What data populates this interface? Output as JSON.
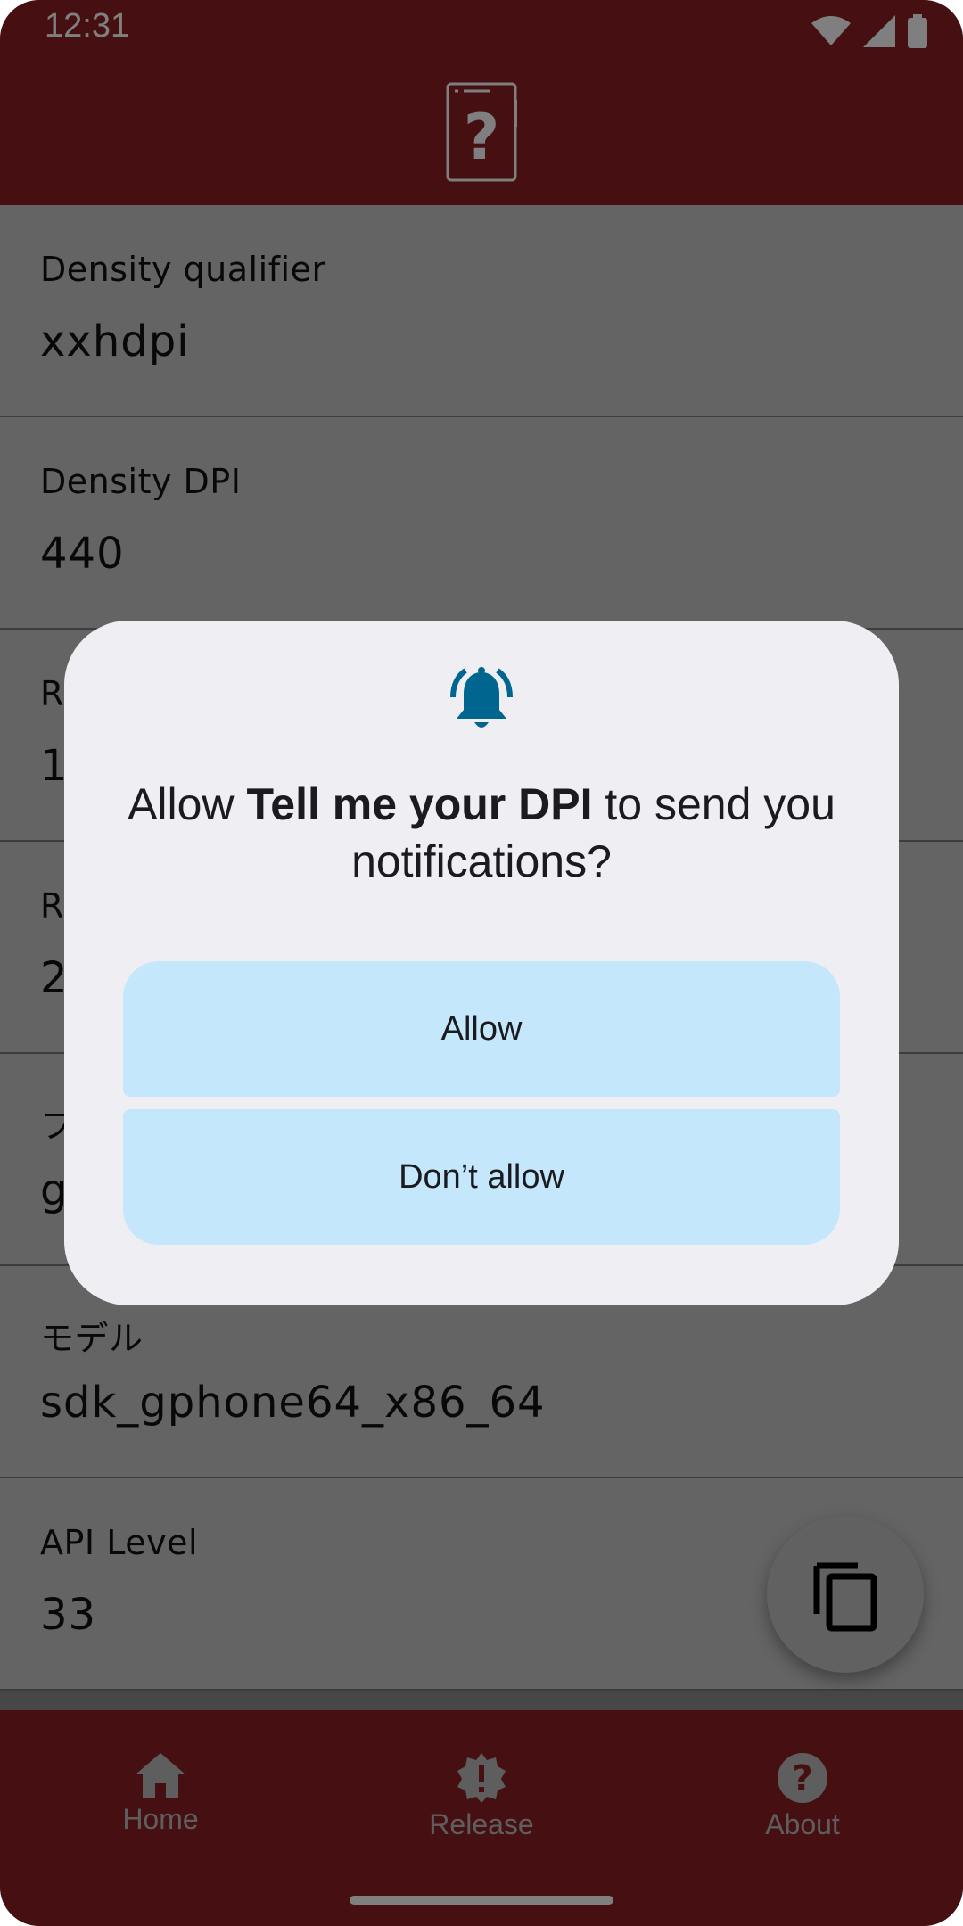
{
  "status_bar": {
    "time": "12:31"
  },
  "list": {
    "items": [
      {
        "label": "Density qualifier",
        "value": "xxhdpi"
      },
      {
        "label": "Density DPI",
        "value": "440"
      },
      {
        "label": "R",
        "value": "1"
      },
      {
        "label": "R",
        "value": "2"
      },
      {
        "label": "フ",
        "value": "g"
      },
      {
        "label": "モデル",
        "value": "sdk_gphone64_x86_64"
      },
      {
        "label": "API Level",
        "value": "33"
      }
    ]
  },
  "bottom_nav": {
    "items": [
      {
        "label": "Home",
        "icon": "home-icon"
      },
      {
        "label": "Release",
        "icon": "release-badge-icon"
      },
      {
        "label": "About",
        "icon": "help-circle-icon"
      }
    ]
  },
  "dialog": {
    "title_prefix": "Allow ",
    "app_name": "Tell me your DPI",
    "title_suffix": " to send you notifications?",
    "allow_label": "Allow",
    "deny_label": "Don’t allow",
    "icon": "notification-bell-icon"
  },
  "fab": {
    "icon": "copy-icon"
  },
  "colors": {
    "app_bar": "#8c1e22",
    "dialog_bg": "#efeff3",
    "dialog_button": "#c4e7fc",
    "bell_icon": "#00658f"
  }
}
